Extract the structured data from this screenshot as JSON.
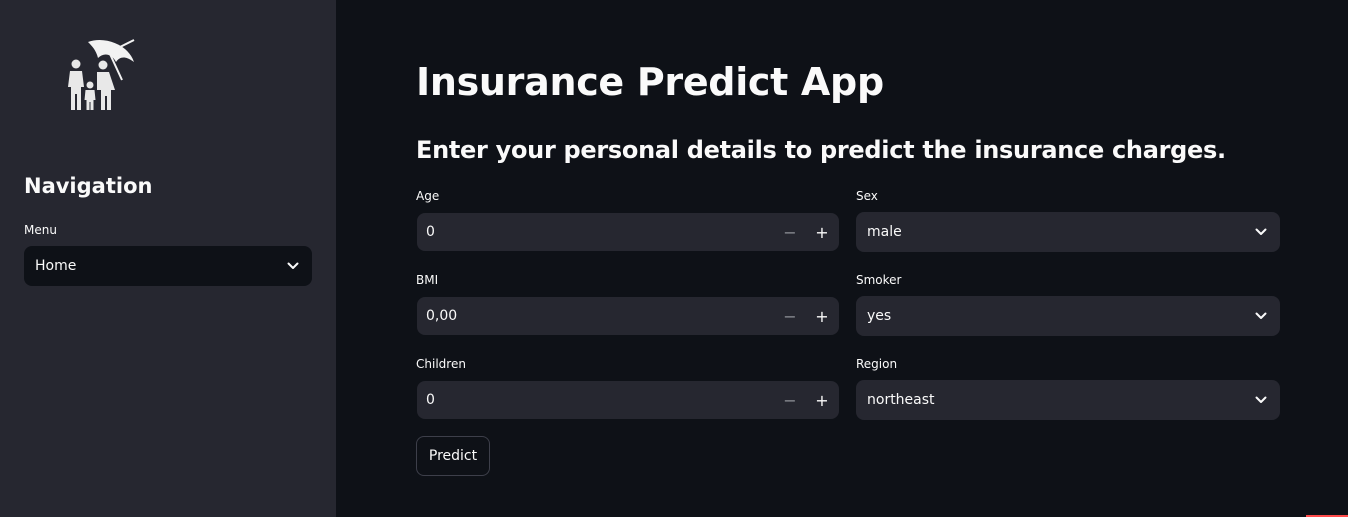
{
  "sidebar": {
    "logo_icon": "family-umbrella-icon",
    "nav_title": "Navigation",
    "menu_label": "Menu",
    "menu_value": "Home"
  },
  "main": {
    "title": "Insurance Predict App",
    "subtitle": "Enter your personal details to predict the insurance charges.",
    "fields": {
      "age": {
        "label": "Age",
        "value": "0"
      },
      "sex": {
        "label": "Sex",
        "value": "male"
      },
      "bmi": {
        "label": "BMI",
        "value": "0,00"
      },
      "smoker": {
        "label": "Smoker",
        "value": "yes"
      },
      "children": {
        "label": "Children",
        "value": "0"
      },
      "region": {
        "label": "Region",
        "value": "northeast"
      }
    },
    "stepper": {
      "minus": "−",
      "plus": "+"
    },
    "predict_label": "Predict"
  },
  "colors": {
    "background": "#0e1117",
    "sidebar": "#262730",
    "input": "#262730",
    "text": "#fafafa",
    "accent": "#ff4b4b"
  }
}
